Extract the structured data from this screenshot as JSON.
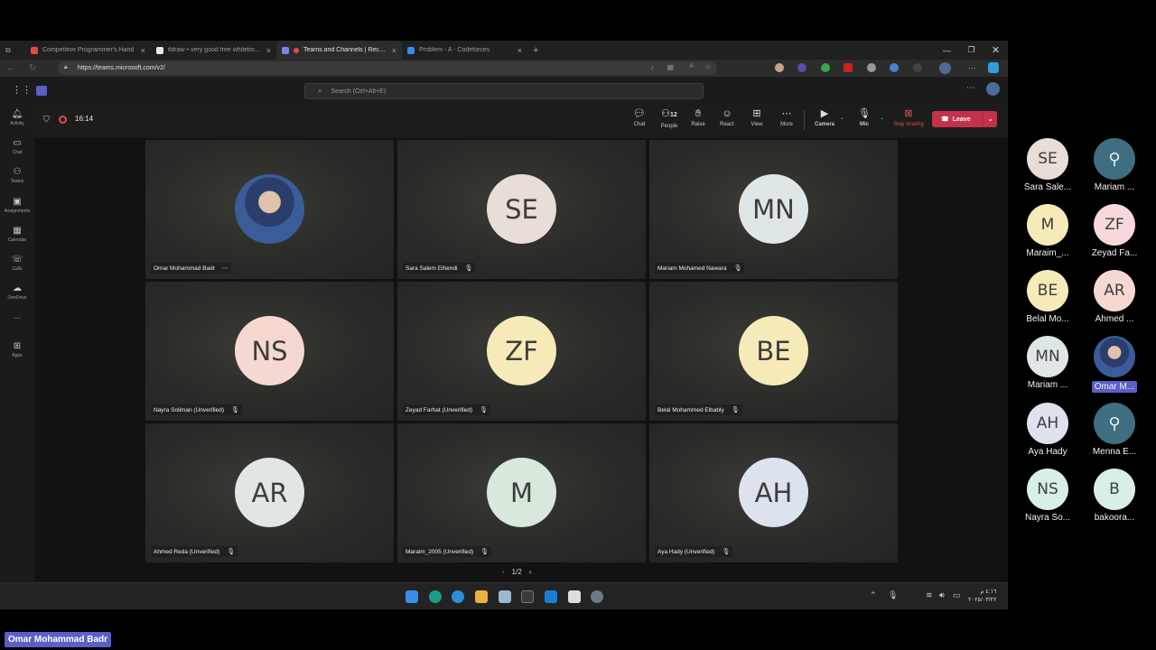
{
  "browser": {
    "tabs": [
      {
        "title": "Competitive Programmer's Hand",
        "color": "#e34a4a"
      },
      {
        "title": "tldraw • very good free whiteboard",
        "color": "#e8e8e8"
      },
      {
        "title": "Teams and Channels | Recording",
        "color": "#7b83eb"
      },
      {
        "title": "Problem - A - Codeforces",
        "color": "#3b8beb"
      }
    ],
    "url": "https://teams.microsoft.com/v2/"
  },
  "teams": {
    "search_placeholder": "Search (Ctrl+Alt+E)",
    "rail": [
      "Activity",
      "Chat",
      "Teams",
      "Assignments",
      "Calendar",
      "Calls",
      "OneDrive",
      "...",
      "Apps"
    ],
    "meeting_time": "16:14",
    "toolbar": {
      "chat": "Chat",
      "people": "People",
      "people_count": "12",
      "raise": "Raise",
      "react": "React",
      "view": "View",
      "more": "More",
      "camera": "Camera",
      "mic": "Mic",
      "stop_sharing": "Stop sharing",
      "leave": "Leave"
    },
    "tiles": [
      {
        "initials": "",
        "name": "Omar Mohammad Badr",
        "bg": "#4d6a9a",
        "photo": true
      },
      {
        "initials": "SE",
        "name": "Sara Salem Elhendi",
        "bg": "#e8ddd7"
      },
      {
        "initials": "MN",
        "name": "Mariam Mohamed Nawara",
        "bg": "#dfe6e8"
      },
      {
        "initials": "NS",
        "name": "Nayra Soliman (Unverified)",
        "bg": "#f6d8d2"
      },
      {
        "initials": "ZF",
        "name": "Zeyad Farhat (Unverified)",
        "bg": "#f6eab8"
      },
      {
        "initials": "BE",
        "name": "Belal Mohammed Elbably",
        "bg": "#f6eab8"
      },
      {
        "initials": "AR",
        "name": "Ahmed Reda (Unverified)",
        "bg": "#e0e6e6"
      },
      {
        "initials": "M",
        "name": "Maraim_2005 (Unverified)",
        "bg": "#d8e9dc"
      },
      {
        "initials": "AH",
        "name": "Aya Hady (Unverified)",
        "bg": "#dce3ee"
      }
    ],
    "pagination": "1/2"
  },
  "taskbar": {
    "time": "٤:١٦ م",
    "date": "٢٠٢٥/٠٣/٢٢"
  },
  "roster": [
    {
      "initials": "SE",
      "name": "Sara Sale...",
      "bg": "#e8ddd7"
    },
    {
      "initials": "",
      "name": "Mariam ...",
      "bg": "#3e6e80",
      "icon": true
    },
    {
      "initials": "M",
      "name": "Maraim_...",
      "bg": "#f6eab8"
    },
    {
      "initials": "ZF",
      "name": "Zeyad Fa...",
      "bg": "#f7d9dc"
    },
    {
      "initials": "BE",
      "name": "Belal Mo...",
      "bg": "#f6eab8"
    },
    {
      "initials": "AR",
      "name": "Ahmed ...",
      "bg": "#f6d8d2"
    },
    {
      "initials": "MN",
      "name": "Mariam ...",
      "bg": "#dfe6e8"
    },
    {
      "initials": "",
      "name": "Omar M...",
      "bg": "#4d6a9a",
      "photo": true,
      "highlight": true
    },
    {
      "initials": "AH",
      "name": "Aya Hady",
      "bg": "#dce3ee"
    },
    {
      "initials": "",
      "name": "Menna E...",
      "bg": "#3e6e80",
      "icon": true
    },
    {
      "initials": "NS",
      "name": "Nayra So...",
      "bg": "#d8eee9"
    },
    {
      "initials": "B",
      "name": "bakoora...",
      "bg": "#d8eee9"
    }
  ],
  "speaker_label": "Omar Mohammad Badr",
  "colors": {
    "leave": "#c4314b",
    "accent": "#5b5fc7"
  }
}
